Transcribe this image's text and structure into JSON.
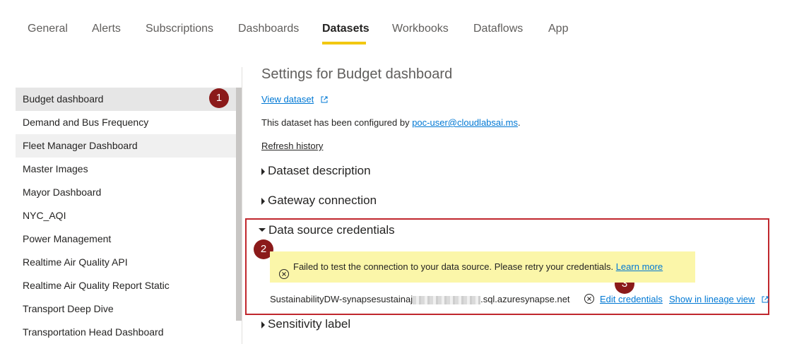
{
  "tabs": [
    {
      "label": "General"
    },
    {
      "label": "Alerts"
    },
    {
      "label": "Subscriptions"
    },
    {
      "label": "Dashboards"
    },
    {
      "label": "Datasets"
    },
    {
      "label": "Workbooks"
    },
    {
      "label": "Dataflows"
    },
    {
      "label": "App"
    }
  ],
  "active_tab": "Datasets",
  "accent_color": "#f2c811",
  "callout_color": "#8b1a1a",
  "datasets": [
    {
      "label": "Budget dashboard"
    },
    {
      "label": "Demand and Bus Frequency"
    },
    {
      "label": "Fleet Manager Dashboard"
    },
    {
      "label": "Master Images"
    },
    {
      "label": "Mayor Dashboard"
    },
    {
      "label": "NYC_AQI"
    },
    {
      "label": "Power Management"
    },
    {
      "label": "Realtime Air Quality API"
    },
    {
      "label": "Realtime Air Quality Report Static"
    },
    {
      "label": "Transport Deep Dive"
    },
    {
      "label": "Transportation Head Dashboard"
    }
  ],
  "selected_dataset": "Budget dashboard",
  "markers": [
    "1",
    "2",
    "3"
  ],
  "settings": {
    "title": "Settings for Budget dashboard",
    "view_dataset": "View dataset",
    "configured_prefix": "This dataset has been configured by ",
    "configured_user": "poc-user@cloudlabsai.ms",
    "configured_suffix": ".",
    "refresh_history": "Refresh history",
    "sections": {
      "dataset_description": "Dataset description",
      "gateway_connection": "Gateway connection",
      "data_source_credentials": "Data source credentials",
      "sensitivity_label": "Sensitivity label"
    },
    "error_message": "Failed to test the connection to your data source. Please retry your credentials.",
    "learn_more": "Learn more",
    "source_prefix": "SustainabilityDW-synapsesustainaj",
    "source_suffix": ".sql.azuresynapse.net",
    "edit_credentials": "Edit credentials",
    "show_lineage": "Show in lineage view"
  }
}
